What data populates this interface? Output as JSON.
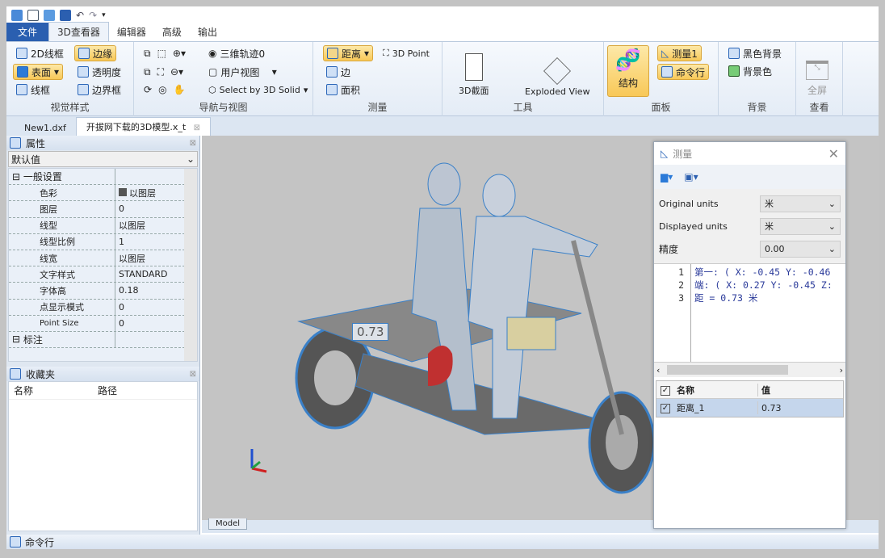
{
  "quick_access": [
    "app-icon",
    "new-icon",
    "open-icon",
    "save-icon",
    "undo-icon",
    "redo-icon",
    "customize-icon"
  ],
  "ribbon_tabs": [
    "文件",
    "3D查看器",
    "编辑器",
    "高级",
    "输出"
  ],
  "groups": {
    "visual_style": {
      "label": "视觉样式",
      "items": [
        "2D线框",
        "边缘",
        "表面",
        "透明度",
        "线框",
        "边界框"
      ]
    },
    "navigation": {
      "label": "导航与视图",
      "items": [
        "三维轨迹0",
        "用户视图",
        "Select by 3D Solid"
      ]
    },
    "measure": {
      "label": "测量",
      "items": [
        "距离",
        "3D Point",
        "边",
        "面积"
      ]
    },
    "tools": {
      "label": "工具",
      "items": [
        "3D截面",
        "Exploded View"
      ]
    },
    "panels": {
      "label": "面板",
      "items": [
        "结构",
        "测量1",
        "命令行"
      ]
    },
    "background": {
      "label": "背景",
      "items": [
        "黑色背景",
        "背景色"
      ]
    },
    "view": {
      "label": "查看",
      "items": [
        "全屏"
      ]
    }
  },
  "doc_tabs": [
    "New1.dxf",
    "开拔网下载的3D模型.x_t"
  ],
  "properties": {
    "title": "属性",
    "preset": "默认值",
    "sections": [
      "一般设置",
      "标注"
    ],
    "rows": [
      [
        "色彩",
        "以图层"
      ],
      [
        "图层",
        "0"
      ],
      [
        "线型",
        "以图层"
      ],
      [
        "线型比例",
        "1"
      ],
      [
        "线宽",
        "以图层"
      ],
      [
        "文字样式",
        "STANDARD"
      ],
      [
        "字体高",
        "0.18"
      ],
      [
        "点显示模式",
        "0"
      ],
      [
        "Point Size",
        "0"
      ]
    ]
  },
  "favorites": {
    "title": "收藏夹",
    "columns": [
      "名称",
      "路径"
    ]
  },
  "viewport": {
    "dimension_label": "0.73",
    "layout_tab": "Model"
  },
  "command_bar": "命令行",
  "measure_dialog": {
    "title": "测量",
    "original_units_label": "Original units",
    "original_units": "米",
    "displayed_units_label": "Displayed units",
    "displayed_units": "米",
    "precision_label": "精度",
    "precision": "0.00",
    "lines": [
      "第一: ( X: -0.45 Y: -0.46",
      "端: ( X: 0.27 Y: -0.45 Z:",
      "距 = 0.73 米"
    ],
    "columns": [
      "名称",
      "值"
    ],
    "rows": [
      [
        "距离_1",
        "0.73"
      ]
    ]
  }
}
